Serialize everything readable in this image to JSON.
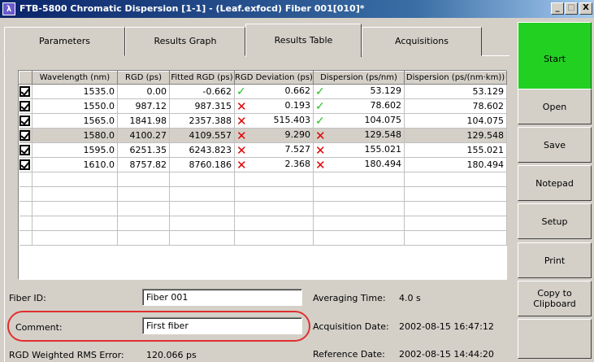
{
  "window": {
    "title": "FTB-5800 Chromatic Dispersion  [1-1] - (Leaf.exfocd) Fiber 001[010]*",
    "minimize": "_",
    "maximize": "□",
    "close": "X",
    "app_icon_glyph": "λ"
  },
  "tabs": [
    {
      "label": "Parameters"
    },
    {
      "label": "Results Graph"
    },
    {
      "label": "Results Table"
    },
    {
      "label": "Acquisitions"
    }
  ],
  "active_tab": "Results Table",
  "table": {
    "headers": [
      "",
      "Wavelength (nm)",
      "RGD (ps)",
      "Fitted RGD (ps)",
      "RGD Deviation (ps)",
      "Dispersion (ps/nm)",
      "Dispersion (ps/(nm·km))"
    ],
    "rows": [
      {
        "checked": true,
        "wavelength": "1535.0",
        "rgd": "0.00",
        "fitted": "-0.662",
        "deviation": "0.662",
        "dev_status": "pass",
        "dispersion": "53.129",
        "disp_status": "pass",
        "disp_km": "53.129"
      },
      {
        "checked": true,
        "wavelength": "1550.0",
        "rgd": "987.12",
        "fitted": "987.315",
        "deviation": "0.193",
        "dev_status": "fail",
        "dispersion": "78.602",
        "disp_status": "pass",
        "disp_km": "78.602"
      },
      {
        "checked": true,
        "wavelength": "1565.0",
        "rgd": "1841.98",
        "fitted": "2357.388",
        "deviation": "515.403",
        "dev_status": "fail",
        "dispersion": "104.075",
        "disp_status": "pass",
        "disp_km": "104.075"
      },
      {
        "checked": true,
        "wavelength": "1580.0",
        "rgd": "4100.27",
        "fitted": "4109.557",
        "deviation": "9.290",
        "dev_status": "fail",
        "dispersion": "129.548",
        "disp_status": "fail",
        "disp_km": "129.548"
      },
      {
        "checked": true,
        "wavelength": "1595.0",
        "rgd": "6251.35",
        "fitted": "6243.823",
        "deviation": "7.527",
        "dev_status": "fail",
        "dispersion": "155.021",
        "disp_status": "fail",
        "disp_km": "155.021"
      },
      {
        "checked": true,
        "wavelength": "1610.0",
        "rgd": "8757.82",
        "fitted": "8760.186",
        "deviation": "2.368",
        "dev_status": "fail",
        "dispersion": "180.494",
        "disp_status": "fail",
        "disp_km": "180.494"
      }
    ],
    "selected_row": 3,
    "empty_rows": 5,
    "colors": {
      "pass": "#22c022",
      "fail": "#e00000"
    }
  },
  "info": {
    "fiber_id_label": "Fiber ID:",
    "fiber_id_value": "Fiber 001",
    "comment_label": "Comment:",
    "comment_value": "First fiber",
    "rms_label": "RGD Weighted RMS Error:",
    "rms_value": "120.066 ps",
    "averaging_label": "Averaging Time:",
    "averaging_value": "4.0 s",
    "acq_date_label": "Acquisition Date:",
    "acq_date_value": "2002-08-15 16:47:12",
    "ref_date_label": "Reference Date:",
    "ref_date_value": "2002-08-15 14:44:20"
  },
  "sidebar": {
    "start": "Start",
    "open": "Open",
    "save": "Save",
    "notepad": "Notepad",
    "setup": "Setup",
    "print": "Print",
    "copy_line1": "Copy to",
    "copy_line2": "Clipboard"
  },
  "colors": {
    "start_button": "#22d022",
    "highlight": "#e03030"
  }
}
